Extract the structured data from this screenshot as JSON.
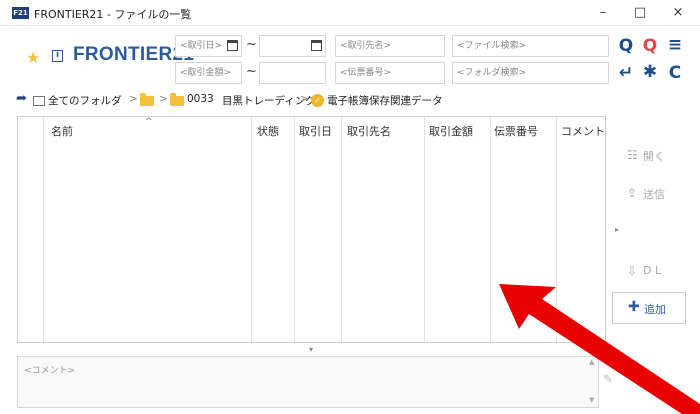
{
  "window": {
    "app_icon_text": "F21",
    "title": "FRONTIER21 - ファイルの一覧",
    "minimize": "–",
    "maximize": "□",
    "close": "×"
  },
  "header": {
    "brand": "FRONTIER21",
    "info_icon_text": "i"
  },
  "search": {
    "date_from_placeholder": "<取引日>",
    "date_to_placeholder": "",
    "amount_from_placeholder": "<取引金額>",
    "amount_to_placeholder": "",
    "tilde": "~",
    "partner_placeholder": "<取引先名>",
    "voucher_placeholder": "<伝票番号>",
    "file_search_placeholder": "<ファイル検索>",
    "folder_search_placeholder": "<フォルダ検索>"
  },
  "toolbar": {
    "search_icon": "Q",
    "clear_search_icon": "Q",
    "menu_icon": "≡",
    "enter_icon": "↵",
    "asterisk_icon": "✱",
    "refresh_icon": "C"
  },
  "breadcrumb": {
    "back_icon": "➦",
    "all_folders": "全てのフォルダ",
    "sep": ">",
    "folder_code": "0033",
    "folder_name": "目黒トレーディング",
    "current": "電子帳簿保存関連データ",
    "shield_glyph": "✓"
  },
  "table": {
    "sort_caret": "^",
    "columns": [
      "名前",
      "状態",
      "取引日",
      "取引先名",
      "取引金額",
      "伝票番号",
      "コメント"
    ],
    "rows": []
  },
  "side_buttons": {
    "open": {
      "icon": "☷",
      "label": "開く"
    },
    "send": {
      "icon": "⇪",
      "label": "送信"
    },
    "download": {
      "icon": "⇩",
      "label": "D L"
    },
    "add": {
      "icon": "✚",
      "label": "追加"
    }
  },
  "panel": {
    "collapse_glyph": "▸",
    "expand_glyph": "▾",
    "scroll_up": "▲",
    "scroll_down": "▼",
    "pencil_icon": "✎"
  },
  "comment": {
    "placeholder": "<コメント>"
  },
  "colors": {
    "brand": "#2e5a9e",
    "star": "#f2c744",
    "folder": "#f3c13a",
    "annotation_arrow": "#e80000"
  }
}
